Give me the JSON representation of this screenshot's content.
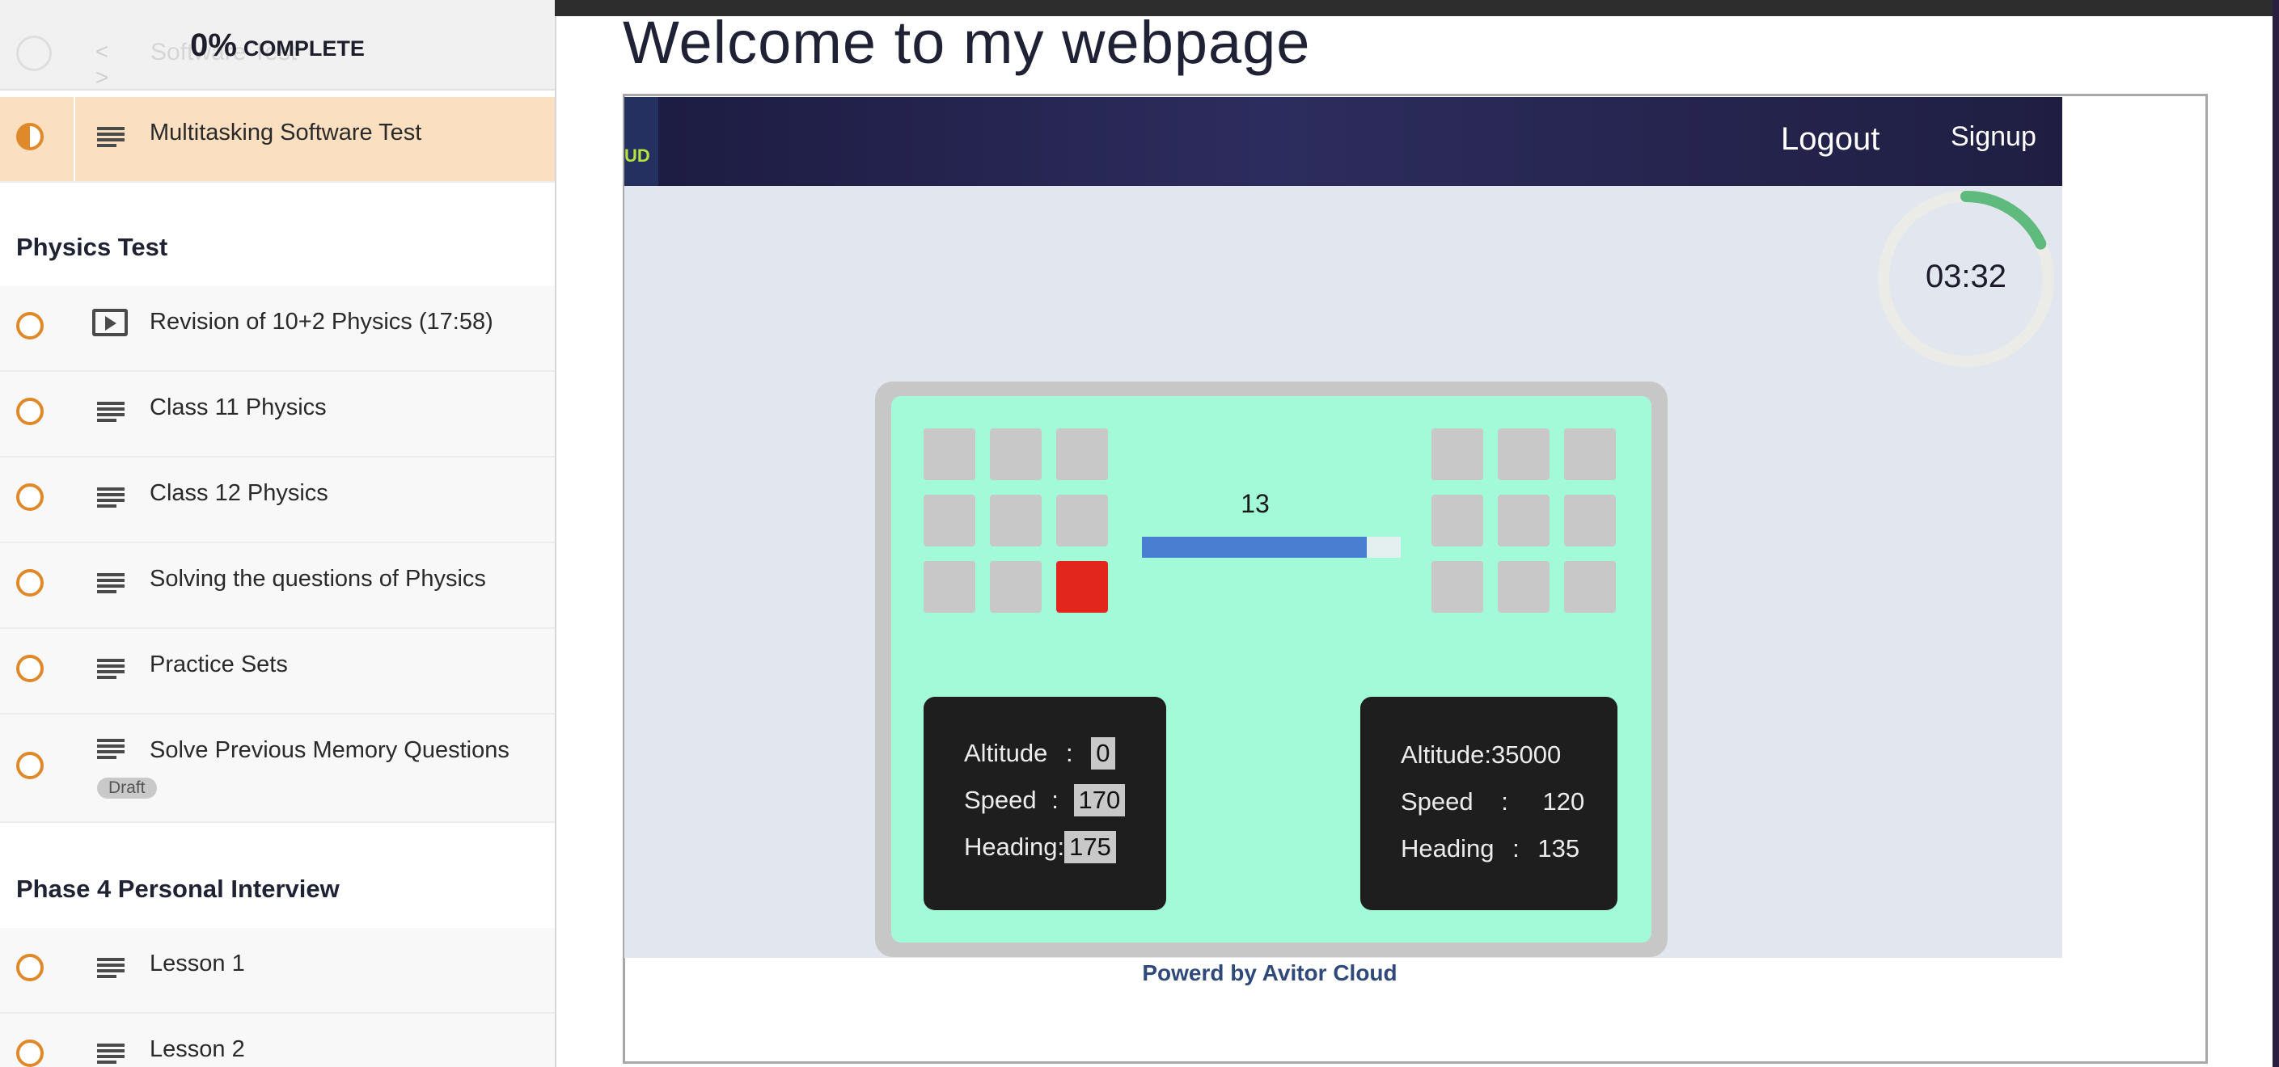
{
  "sidebar": {
    "progress": {
      "percent": "0%",
      "label": "COMPLETE"
    },
    "ghost_item": {
      "code": "< >",
      "text": "Software Test"
    },
    "active_lesson": {
      "title": "Multitasking Software Test"
    },
    "sections": [
      {
        "title": "Physics Test",
        "lessons": [
          {
            "title": "Revision of 10+2 Physics (17:58)",
            "icon": "video-icon"
          },
          {
            "title": "Class 11 Physics",
            "icon": "text-icon"
          },
          {
            "title": "Class 12 Physics",
            "icon": "text-icon"
          },
          {
            "title": "Solving the questions of Physics",
            "icon": "text-icon"
          },
          {
            "title": "Practice Sets",
            "icon": "text-icon"
          },
          {
            "title": "Solve Previous Memory Questions",
            "icon": "text-icon",
            "badge": "Draft"
          }
        ]
      },
      {
        "title": "Phase 4 Personal Interview",
        "lessons": [
          {
            "title": "Lesson 1",
            "icon": "text-icon"
          },
          {
            "title": "Lesson 2",
            "icon": "text-icon"
          }
        ]
      }
    ]
  },
  "main": {
    "heading": "Welcome to my webpage",
    "app": {
      "logo_text": "UD",
      "nav": {
        "logout": "Logout",
        "signup": "Signup"
      },
      "timer": {
        "text": "03:32",
        "fraction": 0.18
      },
      "slider": {
        "value": "13",
        "fraction": 0.87
      },
      "grid_left": {
        "rows": 3,
        "cols": 3,
        "red_index": 8
      },
      "grid_right": {
        "rows": 3,
        "cols": 3
      },
      "panel_left": {
        "altitude_label": "Altitude",
        "altitude_sep": ":",
        "altitude_value": "0",
        "speed_label": "Speed",
        "speed_sep": ":",
        "speed_value": "170",
        "heading_label": "Heading:",
        "heading_value": "175"
      },
      "panel_right": {
        "altitude_text": "Altitude:35000",
        "speed_label": "Speed",
        "speed_sep": ":",
        "speed_value": "120",
        "heading_label": "Heading",
        "heading_sep": ":",
        "heading_value": "135"
      },
      "footer": "Powerd by Avitor Cloud"
    }
  },
  "colors": {
    "accent_orange": "#e0892b",
    "navbar": "#1f1e42",
    "sim_green": "#a3fad9",
    "timer_green": "#5fba7d",
    "red_cell": "#e3261d",
    "slider_blue": "#4a7ed1"
  }
}
